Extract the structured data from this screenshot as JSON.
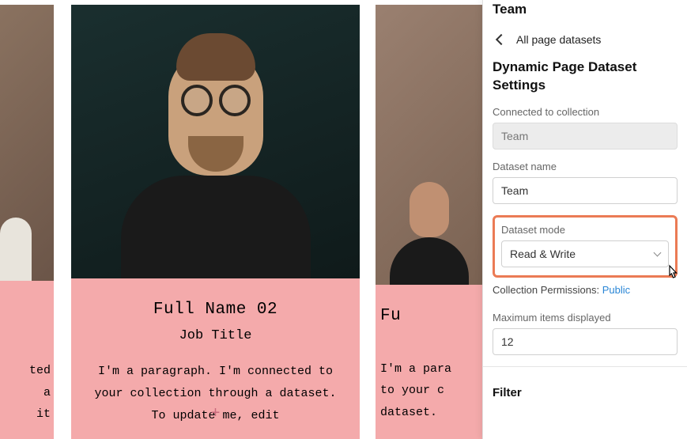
{
  "canvas": {
    "card_left": {
      "paragraph_fragment": "ted\na\nit"
    },
    "card_center": {
      "full_name": "Full Name 02",
      "job_title": "Job Title",
      "paragraph": "I'm a paragraph. I'm connected to your collection through a dataset. To update me, edit"
    },
    "card_right": {
      "full_name_fragment": "Fu",
      "paragraph_fragment": "I'm a para\nto your c\ndataset."
    }
  },
  "panel": {
    "title": "Team",
    "back_label": "All page datasets",
    "section_title": "Dynamic Page Dataset Settings",
    "connected_label": "Connected to collection",
    "connected_value": "Team",
    "dataset_name_label": "Dataset name",
    "dataset_name_value": "Team",
    "dataset_mode_label": "Dataset mode",
    "dataset_mode_value": "Read & Write",
    "permissions_label": "Collection Permissions: ",
    "permissions_value": "Public",
    "max_items_label": "Maximum items displayed",
    "max_items_value": "12",
    "filter_label": "Filter"
  },
  "icons": {
    "chevron_left": "chevron-left-icon",
    "chevron_down": "chevron-down-icon",
    "pointer_cursor": "pointer-cursor-icon"
  }
}
